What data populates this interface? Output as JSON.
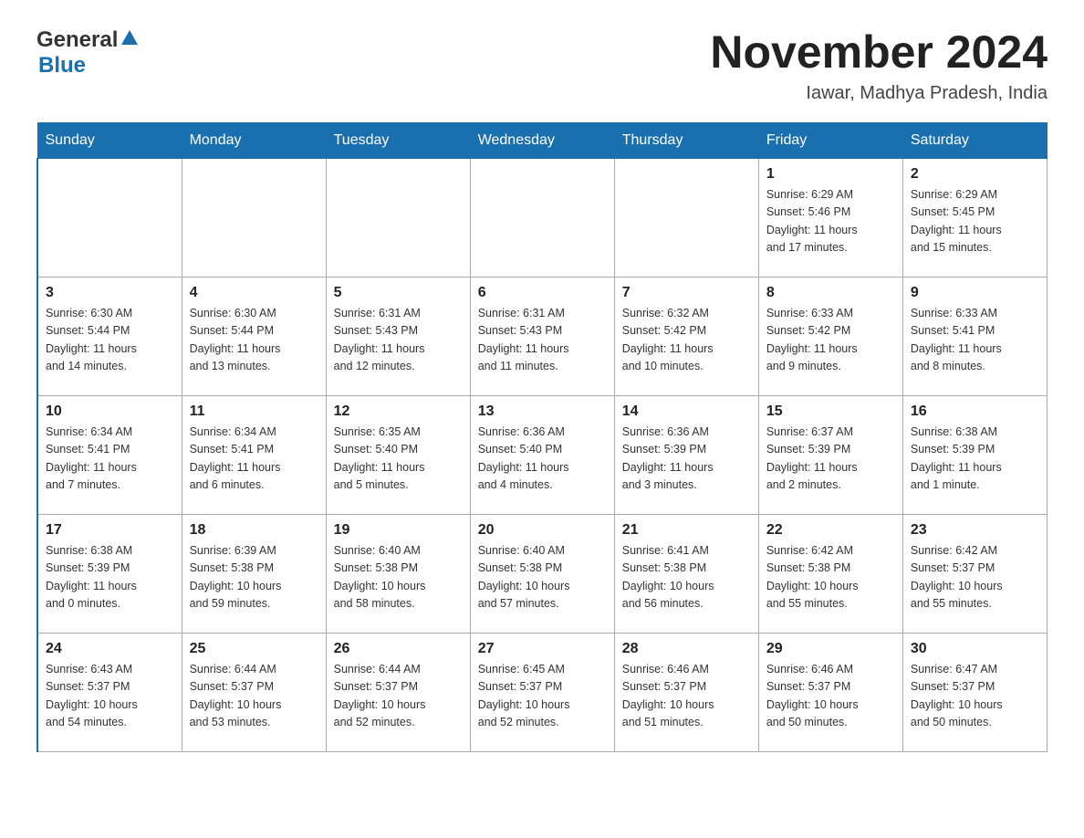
{
  "header": {
    "logo_general": "General",
    "logo_blue": "Blue",
    "month_title": "November 2024",
    "location": "Iawar, Madhya Pradesh, India"
  },
  "days_of_week": [
    "Sunday",
    "Monday",
    "Tuesday",
    "Wednesday",
    "Thursday",
    "Friday",
    "Saturday"
  ],
  "weeks": [
    [
      {
        "day": "",
        "info": ""
      },
      {
        "day": "",
        "info": ""
      },
      {
        "day": "",
        "info": ""
      },
      {
        "day": "",
        "info": ""
      },
      {
        "day": "",
        "info": ""
      },
      {
        "day": "1",
        "info": "Sunrise: 6:29 AM\nSunset: 5:46 PM\nDaylight: 11 hours\nand 17 minutes."
      },
      {
        "day": "2",
        "info": "Sunrise: 6:29 AM\nSunset: 5:45 PM\nDaylight: 11 hours\nand 15 minutes."
      }
    ],
    [
      {
        "day": "3",
        "info": "Sunrise: 6:30 AM\nSunset: 5:44 PM\nDaylight: 11 hours\nand 14 minutes."
      },
      {
        "day": "4",
        "info": "Sunrise: 6:30 AM\nSunset: 5:44 PM\nDaylight: 11 hours\nand 13 minutes."
      },
      {
        "day": "5",
        "info": "Sunrise: 6:31 AM\nSunset: 5:43 PM\nDaylight: 11 hours\nand 12 minutes."
      },
      {
        "day": "6",
        "info": "Sunrise: 6:31 AM\nSunset: 5:43 PM\nDaylight: 11 hours\nand 11 minutes."
      },
      {
        "day": "7",
        "info": "Sunrise: 6:32 AM\nSunset: 5:42 PM\nDaylight: 11 hours\nand 10 minutes."
      },
      {
        "day": "8",
        "info": "Sunrise: 6:33 AM\nSunset: 5:42 PM\nDaylight: 11 hours\nand 9 minutes."
      },
      {
        "day": "9",
        "info": "Sunrise: 6:33 AM\nSunset: 5:41 PM\nDaylight: 11 hours\nand 8 minutes."
      }
    ],
    [
      {
        "day": "10",
        "info": "Sunrise: 6:34 AM\nSunset: 5:41 PM\nDaylight: 11 hours\nand 7 minutes."
      },
      {
        "day": "11",
        "info": "Sunrise: 6:34 AM\nSunset: 5:41 PM\nDaylight: 11 hours\nand 6 minutes."
      },
      {
        "day": "12",
        "info": "Sunrise: 6:35 AM\nSunset: 5:40 PM\nDaylight: 11 hours\nand 5 minutes."
      },
      {
        "day": "13",
        "info": "Sunrise: 6:36 AM\nSunset: 5:40 PM\nDaylight: 11 hours\nand 4 minutes."
      },
      {
        "day": "14",
        "info": "Sunrise: 6:36 AM\nSunset: 5:39 PM\nDaylight: 11 hours\nand 3 minutes."
      },
      {
        "day": "15",
        "info": "Sunrise: 6:37 AM\nSunset: 5:39 PM\nDaylight: 11 hours\nand 2 minutes."
      },
      {
        "day": "16",
        "info": "Sunrise: 6:38 AM\nSunset: 5:39 PM\nDaylight: 11 hours\nand 1 minute."
      }
    ],
    [
      {
        "day": "17",
        "info": "Sunrise: 6:38 AM\nSunset: 5:39 PM\nDaylight: 11 hours\nand 0 minutes."
      },
      {
        "day": "18",
        "info": "Sunrise: 6:39 AM\nSunset: 5:38 PM\nDaylight: 10 hours\nand 59 minutes."
      },
      {
        "day": "19",
        "info": "Sunrise: 6:40 AM\nSunset: 5:38 PM\nDaylight: 10 hours\nand 58 minutes."
      },
      {
        "day": "20",
        "info": "Sunrise: 6:40 AM\nSunset: 5:38 PM\nDaylight: 10 hours\nand 57 minutes."
      },
      {
        "day": "21",
        "info": "Sunrise: 6:41 AM\nSunset: 5:38 PM\nDaylight: 10 hours\nand 56 minutes."
      },
      {
        "day": "22",
        "info": "Sunrise: 6:42 AM\nSunset: 5:38 PM\nDaylight: 10 hours\nand 55 minutes."
      },
      {
        "day": "23",
        "info": "Sunrise: 6:42 AM\nSunset: 5:37 PM\nDaylight: 10 hours\nand 55 minutes."
      }
    ],
    [
      {
        "day": "24",
        "info": "Sunrise: 6:43 AM\nSunset: 5:37 PM\nDaylight: 10 hours\nand 54 minutes."
      },
      {
        "day": "25",
        "info": "Sunrise: 6:44 AM\nSunset: 5:37 PM\nDaylight: 10 hours\nand 53 minutes."
      },
      {
        "day": "26",
        "info": "Sunrise: 6:44 AM\nSunset: 5:37 PM\nDaylight: 10 hours\nand 52 minutes."
      },
      {
        "day": "27",
        "info": "Sunrise: 6:45 AM\nSunset: 5:37 PM\nDaylight: 10 hours\nand 52 minutes."
      },
      {
        "day": "28",
        "info": "Sunrise: 6:46 AM\nSunset: 5:37 PM\nDaylight: 10 hours\nand 51 minutes."
      },
      {
        "day": "29",
        "info": "Sunrise: 6:46 AM\nSunset: 5:37 PM\nDaylight: 10 hours\nand 50 minutes."
      },
      {
        "day": "30",
        "info": "Sunrise: 6:47 AM\nSunset: 5:37 PM\nDaylight: 10 hours\nand 50 minutes."
      }
    ]
  ]
}
